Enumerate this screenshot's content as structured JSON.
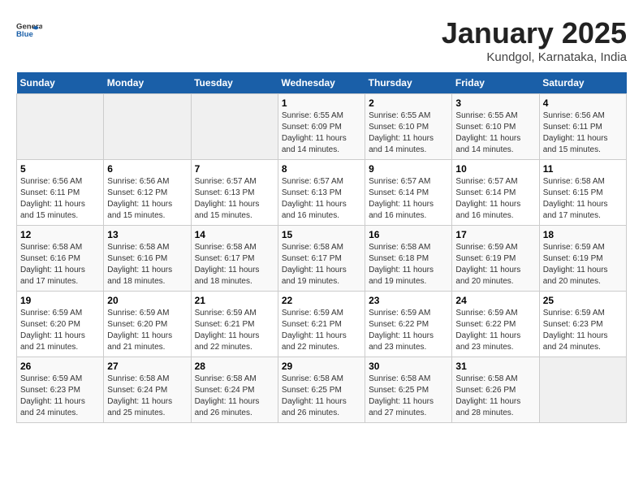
{
  "header": {
    "logo_general": "General",
    "logo_blue": "Blue",
    "month": "January 2025",
    "location": "Kundgol, Karnataka, India"
  },
  "weekdays": [
    "Sunday",
    "Monday",
    "Tuesday",
    "Wednesday",
    "Thursday",
    "Friday",
    "Saturday"
  ],
  "weeks": [
    [
      {
        "day": "",
        "sunrise": "",
        "sunset": "",
        "daylight": ""
      },
      {
        "day": "",
        "sunrise": "",
        "sunset": "",
        "daylight": ""
      },
      {
        "day": "",
        "sunrise": "",
        "sunset": "",
        "daylight": ""
      },
      {
        "day": "1",
        "sunrise": "Sunrise: 6:55 AM",
        "sunset": "Sunset: 6:09 PM",
        "daylight": "Daylight: 11 hours and 14 minutes."
      },
      {
        "day": "2",
        "sunrise": "Sunrise: 6:55 AM",
        "sunset": "Sunset: 6:10 PM",
        "daylight": "Daylight: 11 hours and 14 minutes."
      },
      {
        "day": "3",
        "sunrise": "Sunrise: 6:55 AM",
        "sunset": "Sunset: 6:10 PM",
        "daylight": "Daylight: 11 hours and 14 minutes."
      },
      {
        "day": "4",
        "sunrise": "Sunrise: 6:56 AM",
        "sunset": "Sunset: 6:11 PM",
        "daylight": "Daylight: 11 hours and 15 minutes."
      }
    ],
    [
      {
        "day": "5",
        "sunrise": "Sunrise: 6:56 AM",
        "sunset": "Sunset: 6:11 PM",
        "daylight": "Daylight: 11 hours and 15 minutes."
      },
      {
        "day": "6",
        "sunrise": "Sunrise: 6:56 AM",
        "sunset": "Sunset: 6:12 PM",
        "daylight": "Daylight: 11 hours and 15 minutes."
      },
      {
        "day": "7",
        "sunrise": "Sunrise: 6:57 AM",
        "sunset": "Sunset: 6:13 PM",
        "daylight": "Daylight: 11 hours and 15 minutes."
      },
      {
        "day": "8",
        "sunrise": "Sunrise: 6:57 AM",
        "sunset": "Sunset: 6:13 PM",
        "daylight": "Daylight: 11 hours and 16 minutes."
      },
      {
        "day": "9",
        "sunrise": "Sunrise: 6:57 AM",
        "sunset": "Sunset: 6:14 PM",
        "daylight": "Daylight: 11 hours and 16 minutes."
      },
      {
        "day": "10",
        "sunrise": "Sunrise: 6:57 AM",
        "sunset": "Sunset: 6:14 PM",
        "daylight": "Daylight: 11 hours and 16 minutes."
      },
      {
        "day": "11",
        "sunrise": "Sunrise: 6:58 AM",
        "sunset": "Sunset: 6:15 PM",
        "daylight": "Daylight: 11 hours and 17 minutes."
      }
    ],
    [
      {
        "day": "12",
        "sunrise": "Sunrise: 6:58 AM",
        "sunset": "Sunset: 6:16 PM",
        "daylight": "Daylight: 11 hours and 17 minutes."
      },
      {
        "day": "13",
        "sunrise": "Sunrise: 6:58 AM",
        "sunset": "Sunset: 6:16 PM",
        "daylight": "Daylight: 11 hours and 18 minutes."
      },
      {
        "day": "14",
        "sunrise": "Sunrise: 6:58 AM",
        "sunset": "Sunset: 6:17 PM",
        "daylight": "Daylight: 11 hours and 18 minutes."
      },
      {
        "day": "15",
        "sunrise": "Sunrise: 6:58 AM",
        "sunset": "Sunset: 6:17 PM",
        "daylight": "Daylight: 11 hours and 19 minutes."
      },
      {
        "day": "16",
        "sunrise": "Sunrise: 6:58 AM",
        "sunset": "Sunset: 6:18 PM",
        "daylight": "Daylight: 11 hours and 19 minutes."
      },
      {
        "day": "17",
        "sunrise": "Sunrise: 6:59 AM",
        "sunset": "Sunset: 6:19 PM",
        "daylight": "Daylight: 11 hours and 20 minutes."
      },
      {
        "day": "18",
        "sunrise": "Sunrise: 6:59 AM",
        "sunset": "Sunset: 6:19 PM",
        "daylight": "Daylight: 11 hours and 20 minutes."
      }
    ],
    [
      {
        "day": "19",
        "sunrise": "Sunrise: 6:59 AM",
        "sunset": "Sunset: 6:20 PM",
        "daylight": "Daylight: 11 hours and 21 minutes."
      },
      {
        "day": "20",
        "sunrise": "Sunrise: 6:59 AM",
        "sunset": "Sunset: 6:20 PM",
        "daylight": "Daylight: 11 hours and 21 minutes."
      },
      {
        "day": "21",
        "sunrise": "Sunrise: 6:59 AM",
        "sunset": "Sunset: 6:21 PM",
        "daylight": "Daylight: 11 hours and 22 minutes."
      },
      {
        "day": "22",
        "sunrise": "Sunrise: 6:59 AM",
        "sunset": "Sunset: 6:21 PM",
        "daylight": "Daylight: 11 hours and 22 minutes."
      },
      {
        "day": "23",
        "sunrise": "Sunrise: 6:59 AM",
        "sunset": "Sunset: 6:22 PM",
        "daylight": "Daylight: 11 hours and 23 minutes."
      },
      {
        "day": "24",
        "sunrise": "Sunrise: 6:59 AM",
        "sunset": "Sunset: 6:22 PM",
        "daylight": "Daylight: 11 hours and 23 minutes."
      },
      {
        "day": "25",
        "sunrise": "Sunrise: 6:59 AM",
        "sunset": "Sunset: 6:23 PM",
        "daylight": "Daylight: 11 hours and 24 minutes."
      }
    ],
    [
      {
        "day": "26",
        "sunrise": "Sunrise: 6:59 AM",
        "sunset": "Sunset: 6:23 PM",
        "daylight": "Daylight: 11 hours and 24 minutes."
      },
      {
        "day": "27",
        "sunrise": "Sunrise: 6:58 AM",
        "sunset": "Sunset: 6:24 PM",
        "daylight": "Daylight: 11 hours and 25 minutes."
      },
      {
        "day": "28",
        "sunrise": "Sunrise: 6:58 AM",
        "sunset": "Sunset: 6:24 PM",
        "daylight": "Daylight: 11 hours and 26 minutes."
      },
      {
        "day": "29",
        "sunrise": "Sunrise: 6:58 AM",
        "sunset": "Sunset: 6:25 PM",
        "daylight": "Daylight: 11 hours and 26 minutes."
      },
      {
        "day": "30",
        "sunrise": "Sunrise: 6:58 AM",
        "sunset": "Sunset: 6:25 PM",
        "daylight": "Daylight: 11 hours and 27 minutes."
      },
      {
        "day": "31",
        "sunrise": "Sunrise: 6:58 AM",
        "sunset": "Sunset: 6:26 PM",
        "daylight": "Daylight: 11 hours and 28 minutes."
      },
      {
        "day": "",
        "sunrise": "",
        "sunset": "",
        "daylight": ""
      }
    ]
  ]
}
